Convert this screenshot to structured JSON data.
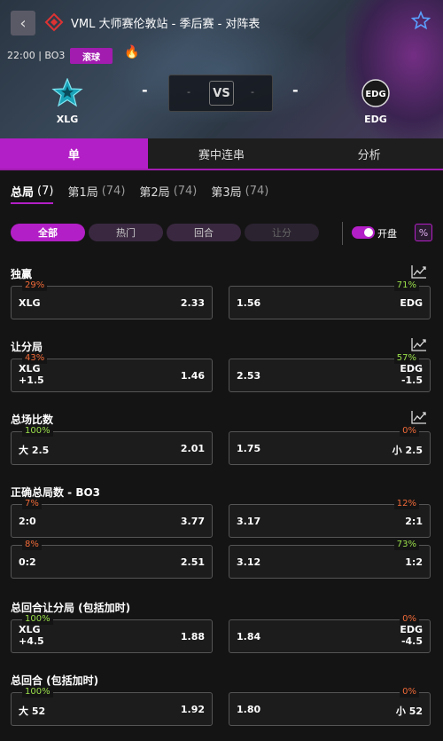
{
  "header": {
    "title": "VML 大师赛伦敦站 - 季后赛 - 对阵表",
    "time": "22:00 | BO3",
    "live_label": "滚球",
    "home_team": "XLG",
    "away_team": "EDG",
    "home_score": "-",
    "away_score": "-",
    "vs": "VS",
    "score_left": "-",
    "score_right": "-"
  },
  "tabs": [
    "单",
    "赛中连串",
    "分析"
  ],
  "map_tabs": [
    {
      "label": "总局",
      "count": "(7)"
    },
    {
      "label": "第1局",
      "count": "(74)"
    },
    {
      "label": "第2局",
      "count": "(74)"
    },
    {
      "label": "第3局",
      "count": "(74)"
    }
  ],
  "filters": [
    "全部",
    "热门",
    "回合",
    "让分"
  ],
  "toggle_label": "开盘",
  "pct_button": "%",
  "markets": [
    {
      "title": "独赢",
      "rows": [
        {
          "left": {
            "label": "XLG",
            "odds": "2.33",
            "pct": "29%",
            "trend": "down"
          },
          "right": {
            "label": "EDG",
            "odds": "1.56",
            "pct": "71%",
            "trend": "up"
          }
        }
      ]
    },
    {
      "title": "让分局",
      "rows": [
        {
          "left": {
            "label": "XLG\n+1.5",
            "odds": "1.46",
            "pct": "43%",
            "trend": "down"
          },
          "right": {
            "label": "EDG\n-1.5",
            "odds": "2.53",
            "pct": "57%",
            "trend": "up"
          }
        }
      ]
    },
    {
      "title": "总场比数",
      "rows": [
        {
          "left": {
            "label": "大 2.5",
            "odds": "2.01",
            "pct": "100%",
            "trend": "up"
          },
          "right": {
            "label": "小 2.5",
            "odds": "1.75",
            "pct": "0%",
            "trend": "down"
          }
        }
      ]
    },
    {
      "title": "正确总局数 - BO3",
      "rows": [
        {
          "left": {
            "label": "2:0",
            "odds": "3.77",
            "pct": "7%",
            "trend": "down"
          },
          "right": {
            "label": "2:1",
            "odds": "3.17",
            "pct": "12%",
            "trend": "down"
          }
        },
        {
          "left": {
            "label": "0:2",
            "odds": "2.51",
            "pct": "8%",
            "trend": "down"
          },
          "right": {
            "label": "1:2",
            "odds": "3.12",
            "pct": "73%",
            "trend": "up"
          }
        }
      ]
    },
    {
      "title": "总回合让分局 (包括加时)",
      "rows": [
        {
          "left": {
            "label": "XLG\n+4.5",
            "odds": "1.88",
            "pct": "100%",
            "trend": "up"
          },
          "right": {
            "label": "EDG\n-4.5",
            "odds": "1.84",
            "pct": "0%",
            "trend": "down"
          }
        }
      ]
    },
    {
      "title": "总回合 (包括加时)",
      "rows": [
        {
          "left": {
            "label": "大 52",
            "odds": "1.92",
            "pct": "100%",
            "trend": "up"
          },
          "right": {
            "label": "小 52",
            "odds": "1.80",
            "pct": "0%",
            "trend": "down"
          }
        }
      ]
    }
  ],
  "colors": {
    "accent": "#b31fc6",
    "up": "#9be04b",
    "down": "#f06a38",
    "bg": "#141414"
  }
}
